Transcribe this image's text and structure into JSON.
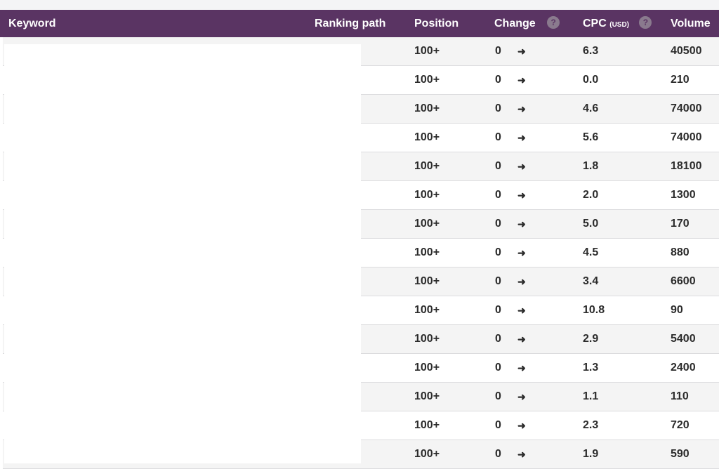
{
  "table": {
    "headers": {
      "keyword": "Keyword",
      "ranking_path": "Ranking path",
      "position": "Position",
      "change": "Change",
      "cpc": "CPC",
      "cpc_unit": "(USD)",
      "volume": "Volume",
      "help_glyph": "?"
    },
    "rows": [
      {
        "position": "100+",
        "change": "0",
        "cpc": "6.3",
        "volume": "40500"
      },
      {
        "position": "100+",
        "change": "0",
        "cpc": "0.0",
        "volume": "210"
      },
      {
        "position": "100+",
        "change": "0",
        "cpc": "4.6",
        "volume": "74000"
      },
      {
        "position": "100+",
        "change": "0",
        "cpc": "5.6",
        "volume": "74000"
      },
      {
        "position": "100+",
        "change": "0",
        "cpc": "1.8",
        "volume": "18100"
      },
      {
        "position": "100+",
        "change": "0",
        "cpc": "2.0",
        "volume": "1300"
      },
      {
        "position": "100+",
        "change": "0",
        "cpc": "5.0",
        "volume": "170"
      },
      {
        "position": "100+",
        "change": "0",
        "cpc": "4.5",
        "volume": "880"
      },
      {
        "position": "100+",
        "change": "0",
        "cpc": "3.4",
        "volume": "6600"
      },
      {
        "position": "100+",
        "change": "0",
        "cpc": "10.8",
        "volume": "90"
      },
      {
        "position": "100+",
        "change": "0",
        "cpc": "2.9",
        "volume": "5400"
      },
      {
        "position": "100+",
        "change": "0",
        "cpc": "1.3",
        "volume": "2400"
      },
      {
        "position": "100+",
        "change": "0",
        "cpc": "1.1",
        "volume": "110"
      },
      {
        "position": "100+",
        "change": "0",
        "cpc": "2.3",
        "volume": "720"
      },
      {
        "position": "100+",
        "change": "0",
        "cpc": "1.9",
        "volume": "590"
      }
    ],
    "change_arrow_icon": "arrow-right-icon",
    "change_arrow_glyph": "➜"
  },
  "colors": {
    "header_background": "#5a3463",
    "header_text": "#ffffff",
    "row_stripe": "#f4f4f4",
    "row_plain": "#ffffff",
    "cell_text": "#2b2b2b"
  }
}
